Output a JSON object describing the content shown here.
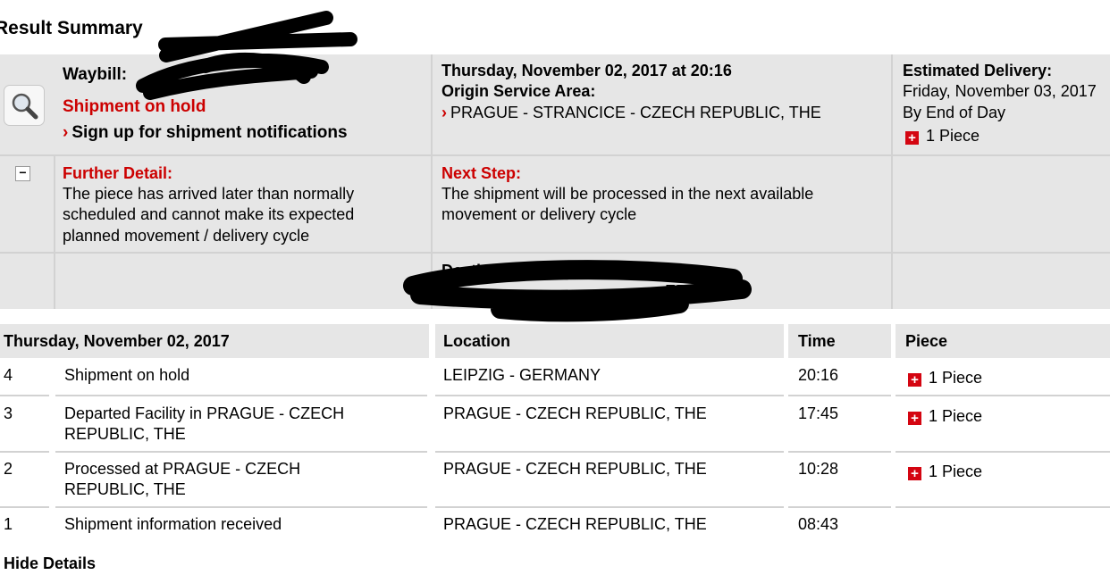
{
  "page_title": "Result Summary",
  "summary": {
    "waybill_label": "Waybill:",
    "status": "Shipment on hold",
    "signup_link": "Sign up for shipment notifications",
    "datetime": "Thursday, November 02, 2017 at 20:16",
    "origin_label": "Origin Service Area:",
    "origin_value": "PRAGUE - STRANCICE - CZECH REPUBLIC, THE",
    "est_label": "Estimated Delivery:",
    "est_date": "Friday, November 03, 2017",
    "est_time": "By End of Day",
    "pieces": "1 Piece",
    "further_label": "Further Detail:",
    "further_lines": [
      "The piece has arrived later than normally",
      "scheduled and cannot make its expected",
      "planned movement / delivery cycle"
    ],
    "next_label": "Next Step:",
    "next_lines": [
      "The shipment will be processed in the next available",
      "movement or delivery cycle"
    ],
    "dest_label": "Destination Service Area:",
    "dest_value_partial": "ERMANY"
  },
  "events": {
    "headers": [
      "Thursday, November 02, 2017",
      "Location",
      "Time",
      "Piece"
    ],
    "rows": [
      {
        "num": "4",
        "desc1": "Shipment on hold",
        "desc2": "",
        "location": "LEIPZIG - GERMANY",
        "time": "20:16",
        "piece": "1 Piece"
      },
      {
        "num": "3",
        "desc1": "Departed Facility in PRAGUE - CZECH",
        "desc2": "REPUBLIC, THE",
        "location": "PRAGUE - CZECH REPUBLIC, THE",
        "time": "17:45",
        "piece": "1 Piece"
      },
      {
        "num": "2",
        "desc1": "Processed at PRAGUE - CZECH",
        "desc2": "REPUBLIC, THE",
        "location": "PRAGUE - CZECH REPUBLIC, THE",
        "time": "10:28",
        "piece": "1 Piece"
      },
      {
        "num": "1",
        "desc1": "Shipment information received",
        "desc2": "",
        "location": "PRAGUE - CZECH REPUBLIC, THE",
        "time": "08:43",
        "piece": ""
      }
    ]
  },
  "footer_link": "Hide Details",
  "colors": {
    "accent_red": "#cc0000",
    "panel_grey": "#e6e6e6",
    "dhl_red": "#d40511"
  },
  "icons": [
    "magnifier-icon",
    "collapse-minus-icon",
    "chevron-right-icon",
    "piece-plus-icon"
  ]
}
